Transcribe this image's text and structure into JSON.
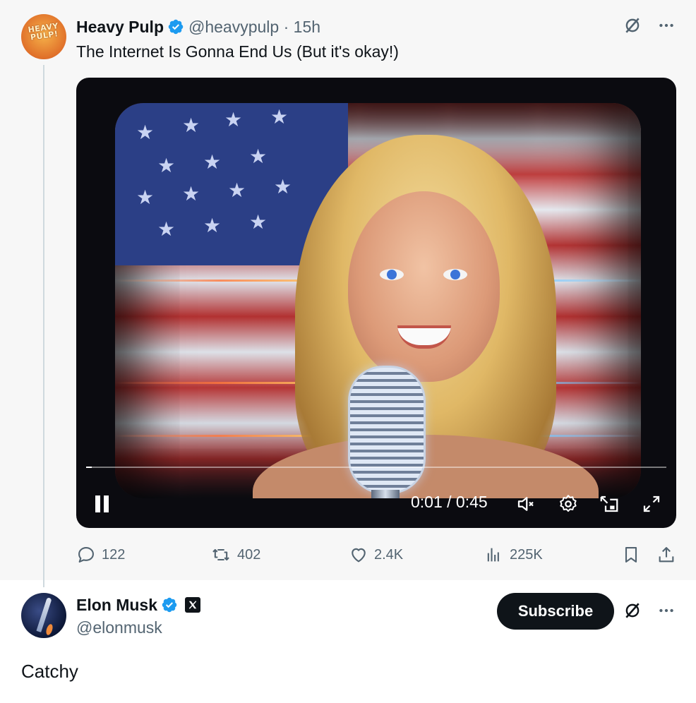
{
  "post1": {
    "author_name": "Heavy Pulp",
    "handle": "@heavypulp",
    "time": "· 15h",
    "text": "The Internet Is Gonna End Us (But it's okay!)",
    "avatar_text": "HEAVY PULP!",
    "video": {
      "time_display": "0:01 / 0:45",
      "progress": 0.01
    },
    "metrics": {
      "replies": "122",
      "reposts": "402",
      "likes": "2.4K",
      "views": "225K"
    }
  },
  "post2": {
    "author_name": "Elon Musk",
    "handle": "@elonmusk",
    "subscribe_label": "Subscribe",
    "text": "Catchy"
  },
  "colors": {
    "verified": "#1d9bf0",
    "text_primary": "#0f1419",
    "text_secondary": "#536471",
    "button_dark": "#0f1419"
  },
  "icons": [
    "verified-icon",
    "grok-icon",
    "more-icon",
    "pause-icon",
    "mute-icon",
    "settings-icon",
    "pip-icon",
    "fullscreen-icon",
    "reply-icon",
    "repost-icon",
    "like-icon",
    "views-icon",
    "bookmark-icon",
    "share-icon",
    "x-badge-icon"
  ]
}
